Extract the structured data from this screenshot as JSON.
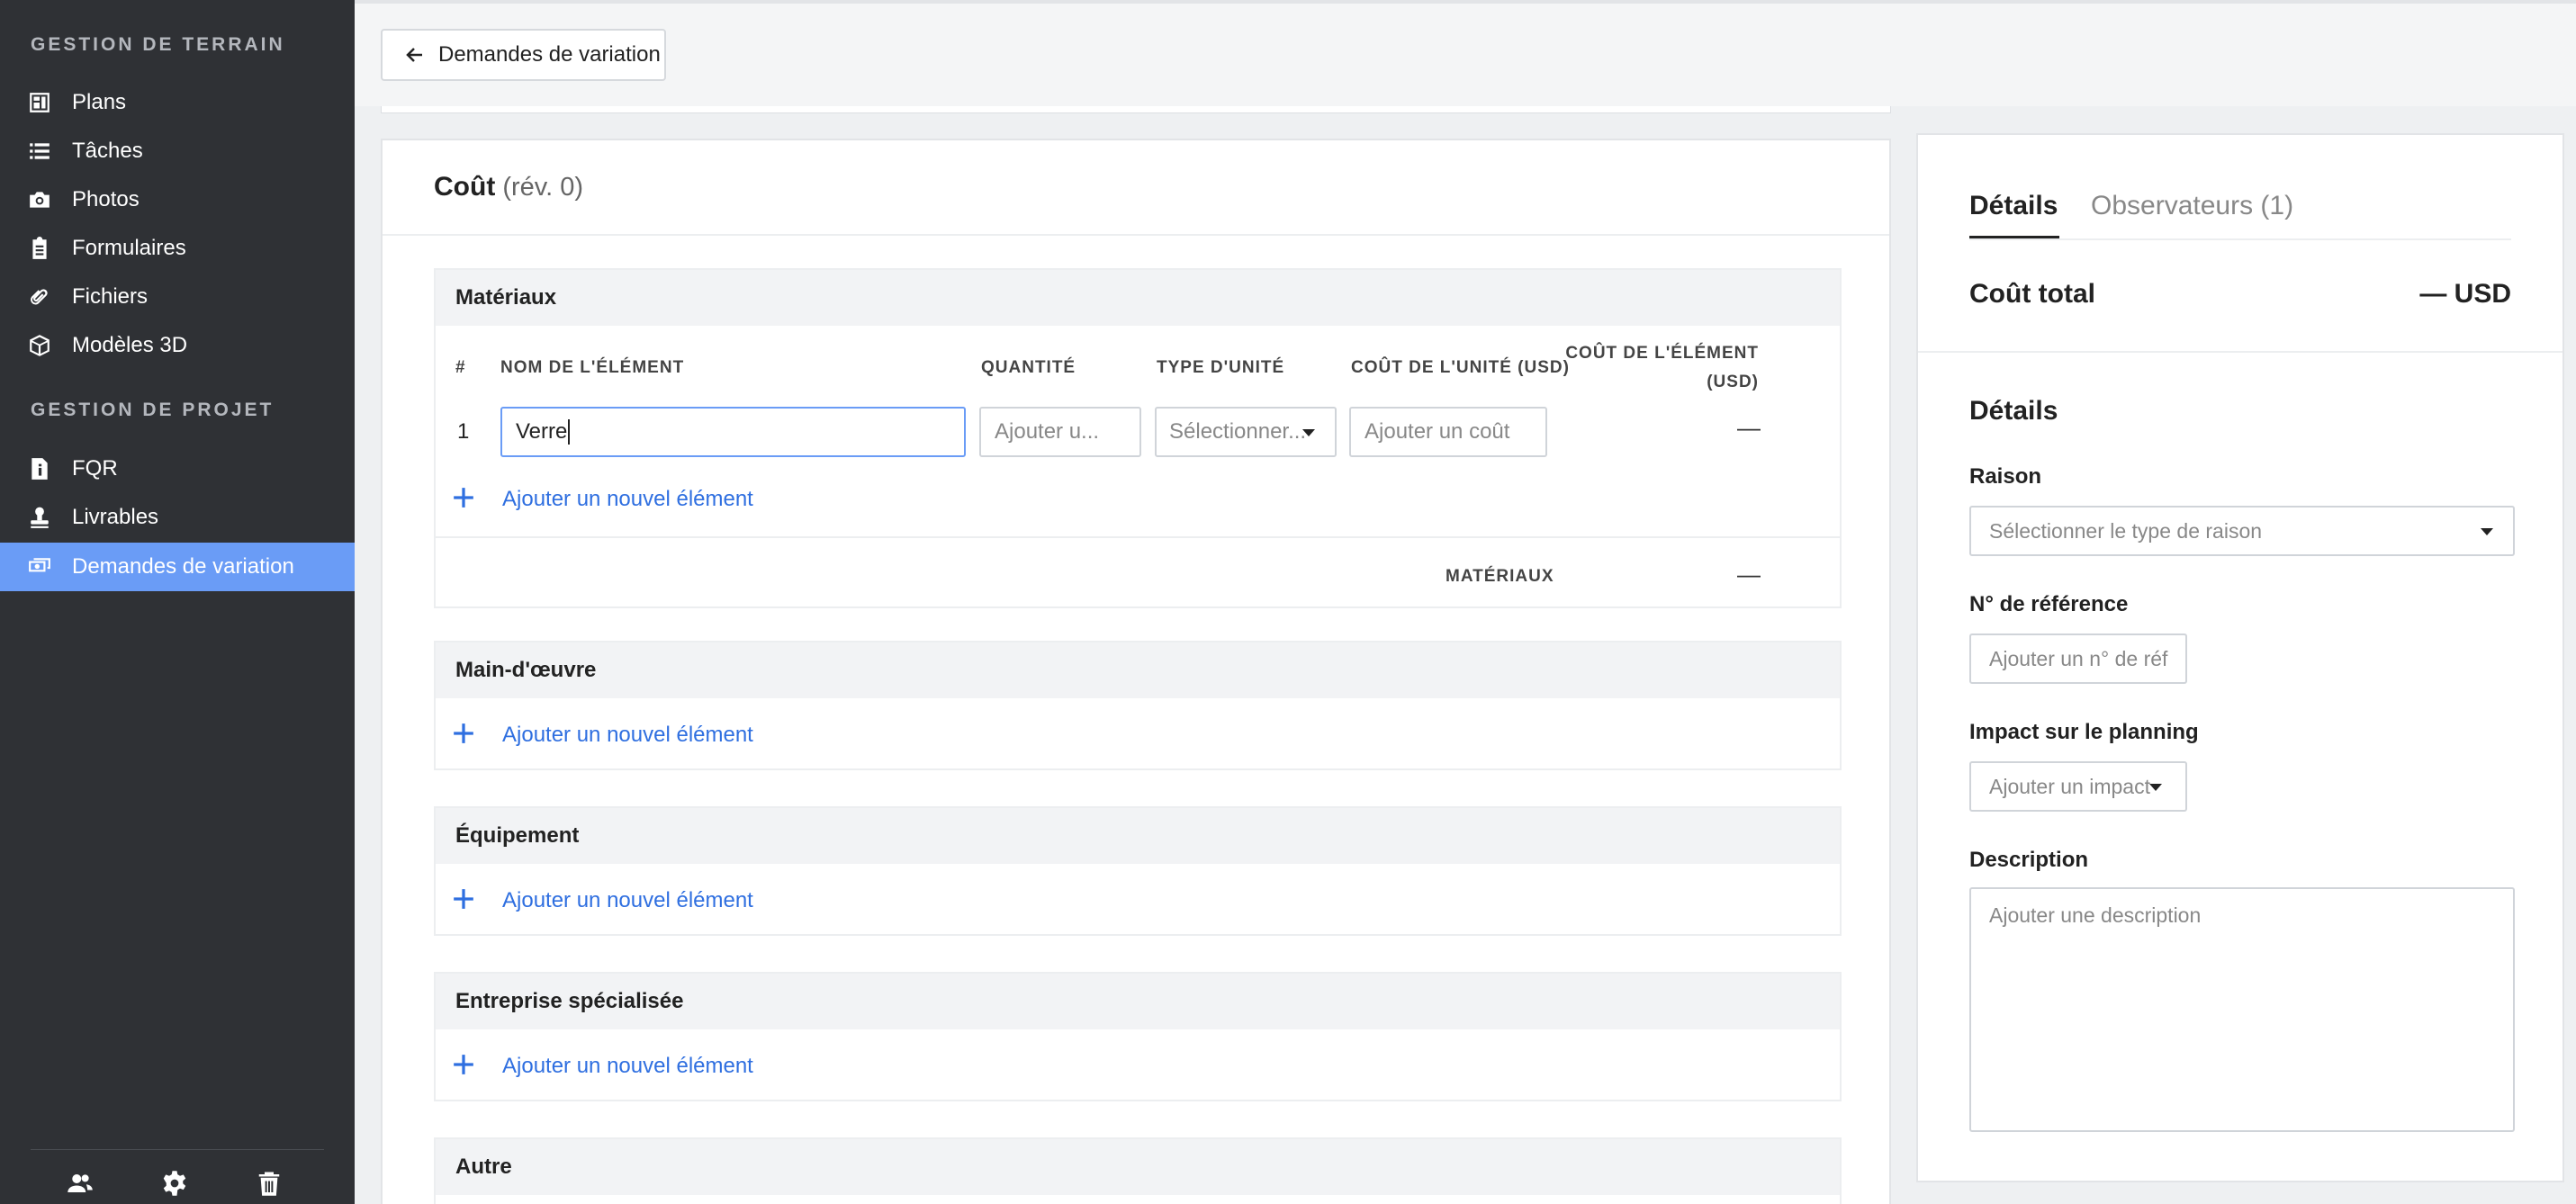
{
  "sidebar": {
    "sections": [
      {
        "title": "GESTION DE TERRAIN"
      },
      {
        "title": "GESTION DE PROJET"
      }
    ],
    "items": [
      {
        "label": "Plans",
        "icon": "plans-icon"
      },
      {
        "label": "Tâches",
        "icon": "tasks-icon"
      },
      {
        "label": "Photos",
        "icon": "camera-icon"
      },
      {
        "label": "Formulaires",
        "icon": "clipboard-icon"
      },
      {
        "label": "Fichiers",
        "icon": "paperclip-icon"
      },
      {
        "label": "Modèles 3D",
        "icon": "cube-icon"
      },
      {
        "label": "FQR",
        "icon": "document-info-icon"
      },
      {
        "label": "Livrables",
        "icon": "stamp-icon"
      },
      {
        "label": "Demandes de variation",
        "icon": "money-icon",
        "active": true
      }
    ],
    "footer_icons": [
      "users-icon",
      "gear-icon",
      "trash-icon"
    ]
  },
  "topbar": {
    "back_label": "Demandes de variation"
  },
  "cost": {
    "title": "Coût",
    "revision": "(rév. 0)",
    "materials": {
      "title": "Matériaux",
      "columns": [
        "#",
        "NOM DE L'ÉLÉMENT",
        "QUANTITÉ",
        "TYPE D'UNITÉ",
        "COÛT DE L'UNITÉ (USD)",
        "COÛT DE L'ÉLÉMENT",
        "(USD)"
      ],
      "row": {
        "index": "1",
        "name_value": "Verre",
        "quantity_placeholder": "Ajouter u...",
        "unit_type_placeholder": "Sélectionner...",
        "unit_cost_placeholder": "Ajouter un coût",
        "item_cost": "—"
      },
      "add_label": "Ajouter un nouvel élément",
      "subtotal_label": "MATÉRIAUX",
      "subtotal_value": "—"
    },
    "labor": {
      "title": "Main-d'œuvre",
      "add_label": "Ajouter un nouvel élément"
    },
    "equipment": {
      "title": "Équipement",
      "add_label": "Ajouter un nouvel élément"
    },
    "subcontractor": {
      "title": "Entreprise spécialisée",
      "add_label": "Ajouter un nouvel élément"
    },
    "other": {
      "title": "Autre"
    }
  },
  "details": {
    "tabs": [
      "Détails",
      "Observateurs (1)"
    ],
    "total_label": "Coût total",
    "total_value": "— USD",
    "section_title": "Détails",
    "reason_label": "Raison",
    "reason_placeholder": "Sélectionner le type de raison",
    "ref_label": "N° de référence",
    "ref_placeholder": "Ajouter un n° de réf",
    "impact_label": "Impact sur le planning",
    "impact_placeholder": "Ajouter un impact",
    "description_label": "Description",
    "description_placeholder": "Ajouter une description"
  },
  "colors": {
    "sidebar_bg": "#2f3135",
    "active_item": "#6a9cf6",
    "link": "#2f6fe0"
  }
}
